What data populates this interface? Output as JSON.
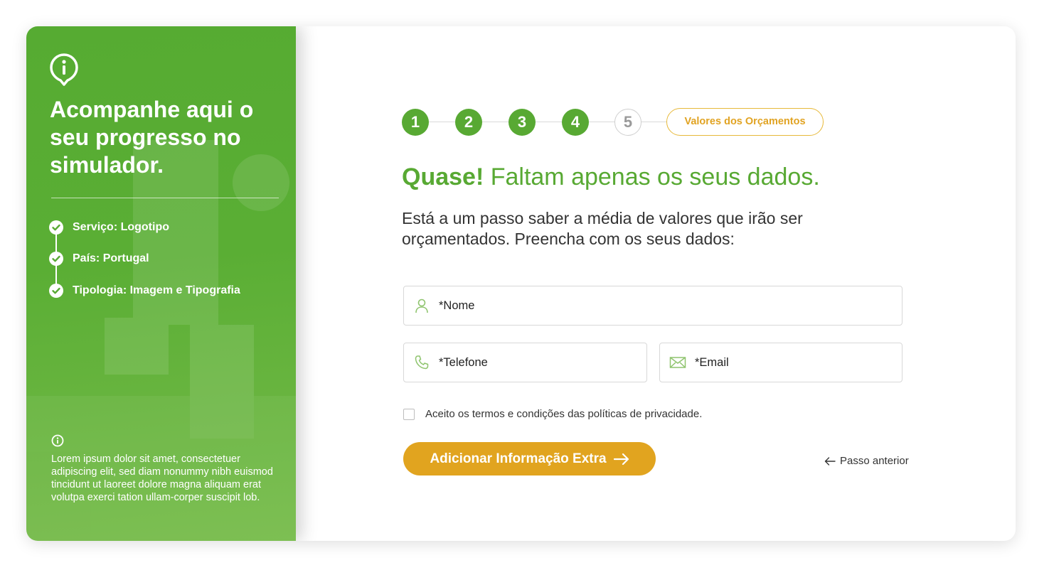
{
  "sidebar": {
    "title": "Acompanhe aqui o seu progresso no simulador.",
    "progress": [
      "Serviço: Logotipo",
      "País: Portugal",
      "Tipologia: Imagem e Tipografia"
    ],
    "note": "Lorem ipsum dolor sit amet, consectetuer adipiscing elit, sed diam nonummy nibh euismod tincidunt ut laoreet dolore magna aliquam erat volutpa exerci tation ullam-corper suscipit lob."
  },
  "steps": {
    "numbers": [
      "1",
      "2",
      "3",
      "4",
      "5"
    ],
    "completed": 4,
    "final_label": "Valores dos Orçamentos"
  },
  "main": {
    "heading_bold": "Quase!",
    "heading_rest": " Faltam apenas os seus dados.",
    "subtitle": "Está a um passo saber a média de valores que irão ser orçamentados. Preencha com os seus dados:"
  },
  "form": {
    "name_placeholder": "*Nome",
    "phone_placeholder": "*Telefone",
    "email_placeholder": "*Email",
    "terms_label": "Aceito os termos e condições das políticas de privacidade.",
    "submit_label": "Adicionar Informação Extra",
    "back_label": "Passo anterior"
  },
  "colors": {
    "green": "#58a933",
    "gold": "#e1a41f"
  },
  "icons": [
    "info-pin-icon",
    "check-circle-icon",
    "info-icon",
    "user-icon",
    "phone-icon",
    "mail-icon",
    "arrow-right-icon",
    "arrow-left-icon"
  ]
}
